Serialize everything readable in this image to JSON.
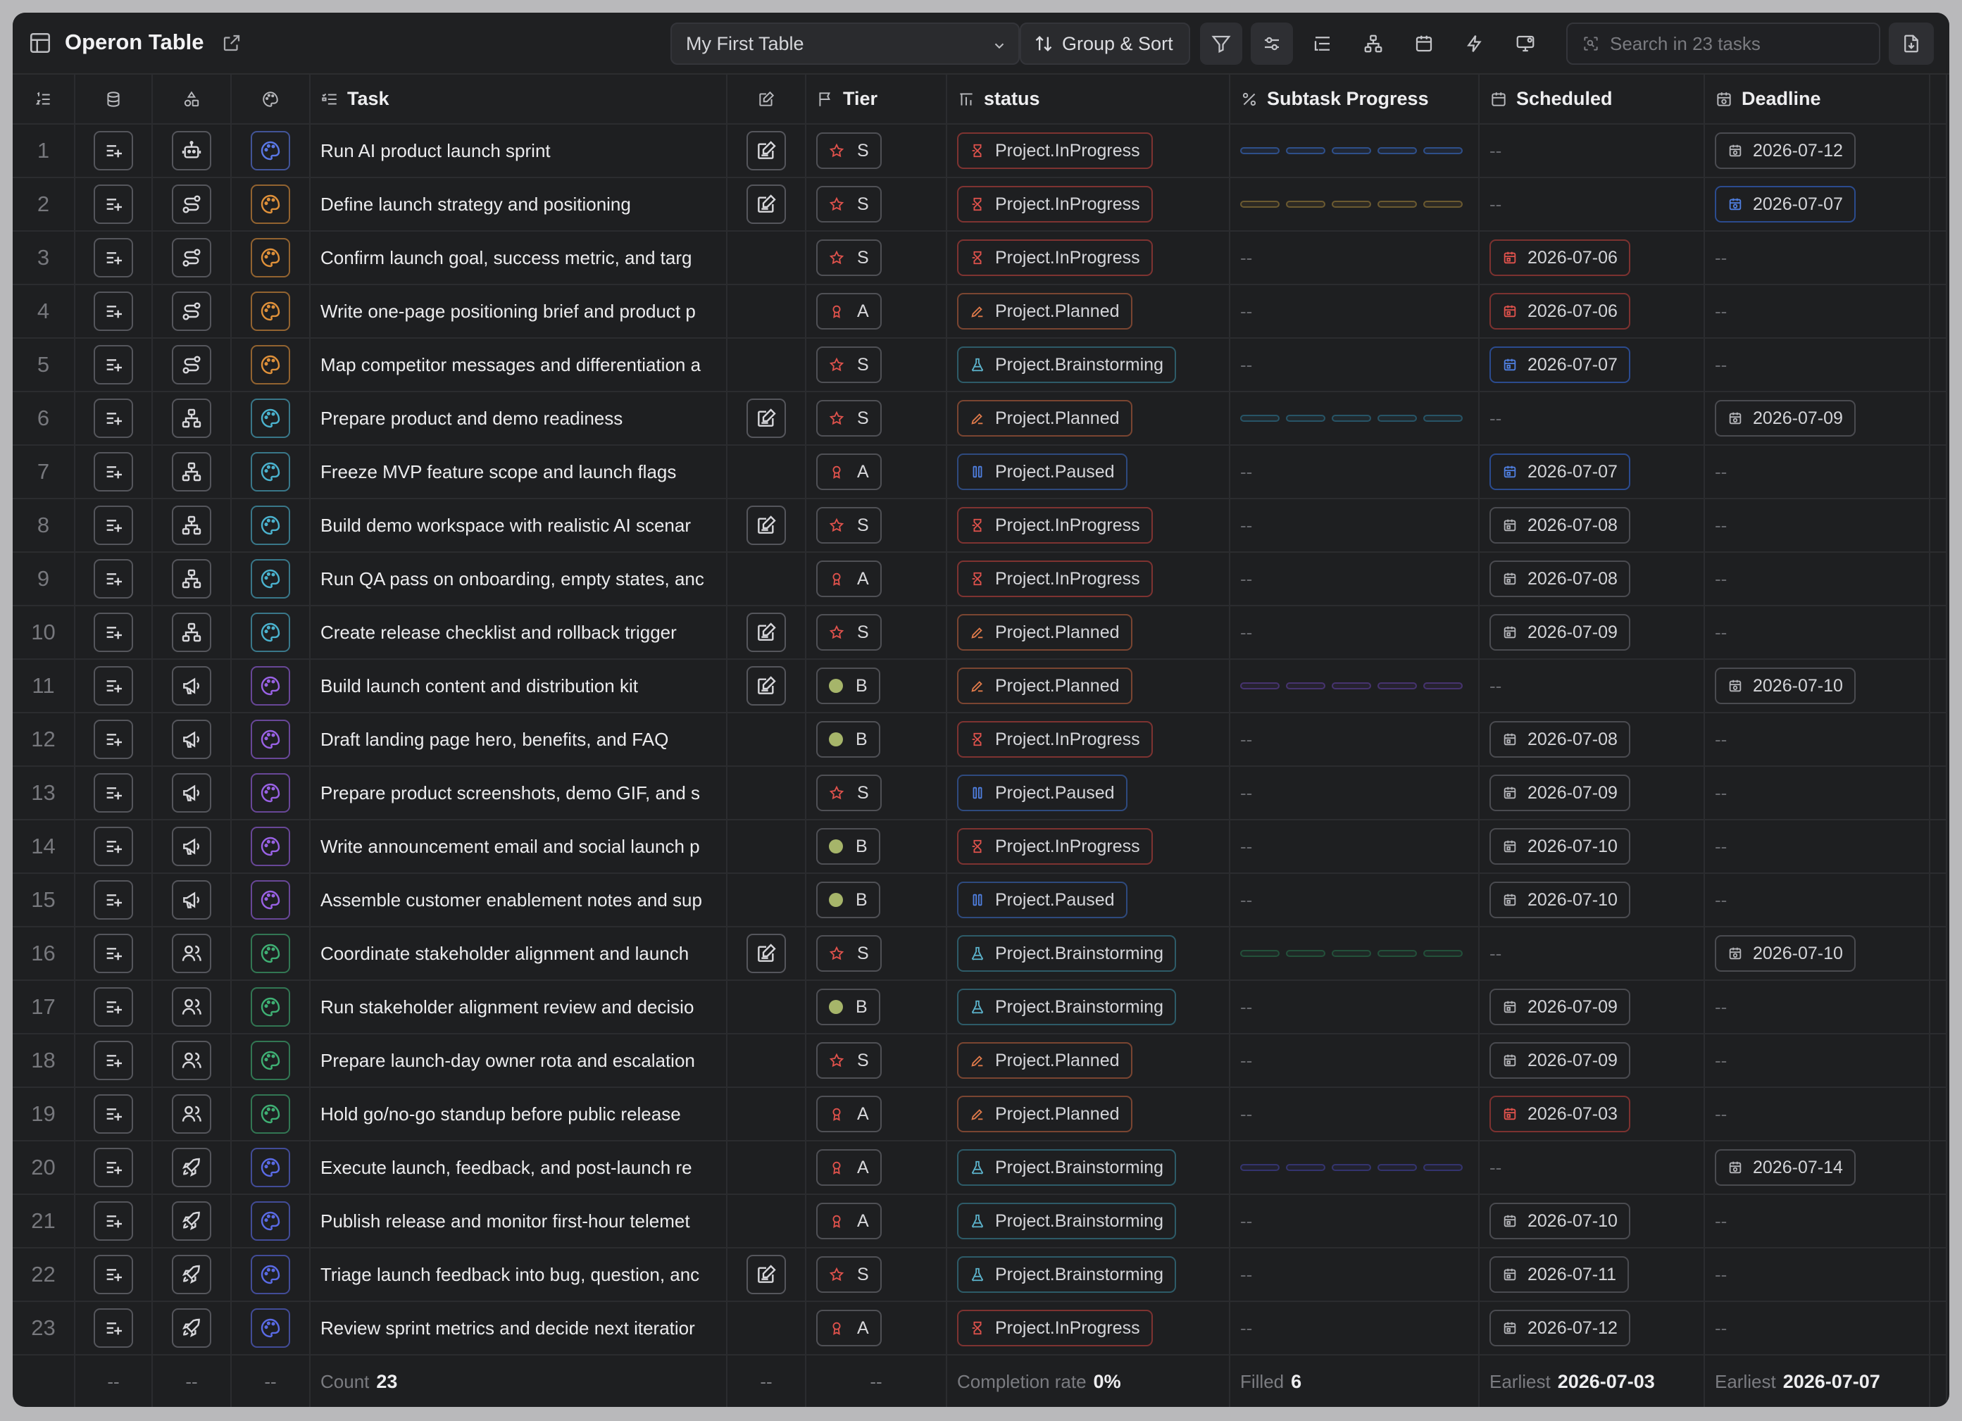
{
  "app": {
    "title": "Operon Table"
  },
  "toolbar": {
    "table_select": "My First Table",
    "group_sort": "Group & Sort",
    "search_placeholder": "Search in 23 tasks"
  },
  "columns": {
    "task": "Task",
    "tier": "Tier",
    "status": "status",
    "progress": "Subtask Progress",
    "scheduled": "Scheduled",
    "deadline": "Deadline"
  },
  "rows": [
    {
      "n": "1",
      "task": "Run AI product launch sprint",
      "cat": "robot-icon",
      "palette": "#5a78e6",
      "notes": true,
      "tier": "S",
      "status": "Project.InProgress",
      "progress": "#2e4f8a",
      "scheduled": null,
      "deadline": "2026-07-12",
      "dl_style": "plain"
    },
    {
      "n": "2",
      "task": "Define launch strategy and positioning",
      "cat": "route-icon",
      "palette": "#e0913a",
      "notes": true,
      "tier": "S",
      "status": "Project.InProgress",
      "progress": "#6b5a30",
      "scheduled": null,
      "deadline": "2026-07-07",
      "dl_style": "blue"
    },
    {
      "n": "3",
      "task": "Confirm launch goal, success metric, and targ",
      "cat": "route-icon",
      "palette": "#e0913a",
      "notes": false,
      "tier": "S",
      "status": "Project.InProgress",
      "progress": null,
      "scheduled": "2026-07-06",
      "sc_style": "red",
      "deadline": null
    },
    {
      "n": "4",
      "task": "Write one-page positioning brief and product p",
      "cat": "route-icon",
      "palette": "#e0913a",
      "notes": false,
      "tier": "A",
      "status": "Project.Planned",
      "progress": null,
      "scheduled": "2026-07-06",
      "sc_style": "red",
      "deadline": null
    },
    {
      "n": "5",
      "task": "Map competitor messages and differentiation a",
      "cat": "route-icon",
      "palette": "#e0913a",
      "notes": false,
      "tier": "S",
      "status": "Project.Brainstorming",
      "progress": null,
      "scheduled": "2026-07-07",
      "sc_style": "blue",
      "deadline": null
    },
    {
      "n": "6",
      "task": "Prepare product and demo readiness",
      "cat": "hierarchy-icon",
      "palette": "#4bb3cf",
      "notes": true,
      "tier": "S",
      "status": "Project.Planned",
      "progress": "#275466",
      "scheduled": null,
      "deadline": "2026-07-09",
      "dl_style": "plain"
    },
    {
      "n": "7",
      "task": "Freeze MVP feature scope and launch flags",
      "cat": "hierarchy-icon",
      "palette": "#4bb3cf",
      "notes": false,
      "tier": "A",
      "status": "Project.Paused",
      "progress": null,
      "scheduled": "2026-07-07",
      "sc_style": "blue",
      "deadline": null
    },
    {
      "n": "8",
      "task": "Build demo workspace with realistic AI scenar",
      "cat": "hierarchy-icon",
      "palette": "#4bb3cf",
      "notes": true,
      "tier": "S",
      "status": "Project.InProgress",
      "progress": null,
      "scheduled": "2026-07-08",
      "sc_style": "plain",
      "deadline": null
    },
    {
      "n": "9",
      "task": "Run QA pass on onboarding, empty states, anc",
      "cat": "hierarchy-icon",
      "palette": "#4bb3cf",
      "notes": false,
      "tier": "A",
      "status": "Project.InProgress",
      "progress": null,
      "scheduled": "2026-07-08",
      "sc_style": "plain",
      "deadline": null
    },
    {
      "n": "10",
      "task": "Create release checklist and rollback trigger",
      "cat": "hierarchy-icon",
      "palette": "#4bb3cf",
      "notes": true,
      "tier": "S",
      "status": "Project.Planned",
      "progress": null,
      "scheduled": "2026-07-09",
      "sc_style": "plain",
      "deadline": null
    },
    {
      "n": "11",
      "task": "Build launch content and distribution kit",
      "cat": "megaphone-icon",
      "palette": "#9a62e6",
      "notes": true,
      "tier": "B",
      "status": "Project.Planned",
      "progress": "#46336f",
      "scheduled": null,
      "deadline": "2026-07-10",
      "dl_style": "plain"
    },
    {
      "n": "12",
      "task": "Draft landing page hero, benefits, and FAQ",
      "cat": "megaphone-icon",
      "palette": "#9a62e6",
      "notes": false,
      "tier": "B",
      "status": "Project.InProgress",
      "progress": null,
      "scheduled": "2026-07-08",
      "sc_style": "plain",
      "deadline": null
    },
    {
      "n": "13",
      "task": "Prepare product screenshots, demo GIF, and s",
      "cat": "megaphone-icon",
      "palette": "#9a62e6",
      "notes": false,
      "tier": "S",
      "status": "Project.Paused",
      "progress": null,
      "scheduled": "2026-07-09",
      "sc_style": "plain",
      "deadline": null
    },
    {
      "n": "14",
      "task": "Write announcement email and social launch p",
      "cat": "megaphone-icon",
      "palette": "#9a62e6",
      "notes": false,
      "tier": "B",
      "status": "Project.InProgress",
      "progress": null,
      "scheduled": "2026-07-10",
      "sc_style": "plain",
      "deadline": null
    },
    {
      "n": "15",
      "task": "Assemble customer enablement notes and sup",
      "cat": "megaphone-icon",
      "palette": "#9a62e6",
      "notes": false,
      "tier": "B",
      "status": "Project.Paused",
      "progress": null,
      "scheduled": "2026-07-10",
      "sc_style": "plain",
      "deadline": null
    },
    {
      "n": "16",
      "task": "Coordinate stakeholder alignment and launch",
      "cat": "users-icon",
      "palette": "#3fb074",
      "notes": true,
      "tier": "S",
      "status": "Project.Brainstorming",
      "progress": "#23503a",
      "scheduled": null,
      "deadline": "2026-07-10",
      "dl_style": "plain"
    },
    {
      "n": "17",
      "task": "Run stakeholder alignment review and decisio",
      "cat": "users-icon",
      "palette": "#3fb074",
      "notes": false,
      "tier": "B",
      "status": "Project.Brainstorming",
      "progress": null,
      "scheduled": "2026-07-09",
      "sc_style": "plain",
      "deadline": null
    },
    {
      "n": "18",
      "task": "Prepare launch-day owner rota and escalation",
      "cat": "users-icon",
      "palette": "#3fb074",
      "notes": false,
      "tier": "S",
      "status": "Project.Planned",
      "progress": null,
      "scheduled": "2026-07-09",
      "sc_style": "plain",
      "deadline": null
    },
    {
      "n": "19",
      "task": "Hold go/no-go standup before public release",
      "cat": "users-icon",
      "palette": "#3fb074",
      "notes": false,
      "tier": "A",
      "status": "Project.Planned",
      "progress": null,
      "scheduled": "2026-07-03",
      "sc_style": "red",
      "deadline": null
    },
    {
      "n": "20",
      "task": "Execute launch, feedback, and post-launch re",
      "cat": "rocket-icon",
      "palette": "#5a6be6",
      "notes": false,
      "tier": "A",
      "status": "Project.Brainstorming",
      "progress": "#34346e",
      "scheduled": null,
      "deadline": "2026-07-14",
      "dl_style": "plain"
    },
    {
      "n": "21",
      "task": "Publish release and monitor first-hour telemet",
      "cat": "rocket-icon",
      "palette": "#5a6be6",
      "notes": false,
      "tier": "A",
      "status": "Project.Brainstorming",
      "progress": null,
      "scheduled": "2026-07-10",
      "sc_style": "plain",
      "deadline": null
    },
    {
      "n": "22",
      "task": "Triage launch feedback into bug, question, anc",
      "cat": "rocket-icon",
      "palette": "#5a6be6",
      "notes": true,
      "tier": "S",
      "status": "Project.Brainstorming",
      "progress": null,
      "scheduled": "2026-07-11",
      "sc_style": "plain",
      "deadline": null
    },
    {
      "n": "23",
      "task": "Review sprint metrics and decide next iteratior",
      "cat": "rocket-icon",
      "palette": "#5a6be6",
      "notes": false,
      "tier": "A",
      "status": "Project.InProgress",
      "progress": null,
      "scheduled": "2026-07-12",
      "sc_style": "plain",
      "deadline": null
    }
  ],
  "footer": {
    "dash": "--",
    "count_label": "Count",
    "count_value": "23",
    "completion_label": "Completion rate",
    "completion_value": "0%",
    "filled_label": "Filled",
    "filled_value": "6",
    "sched_label": "Earliest",
    "sched_value": "2026-07-03",
    "deadline_label": "Earliest",
    "deadline_value": "2026-07-07"
  },
  "empty_cell": "--"
}
